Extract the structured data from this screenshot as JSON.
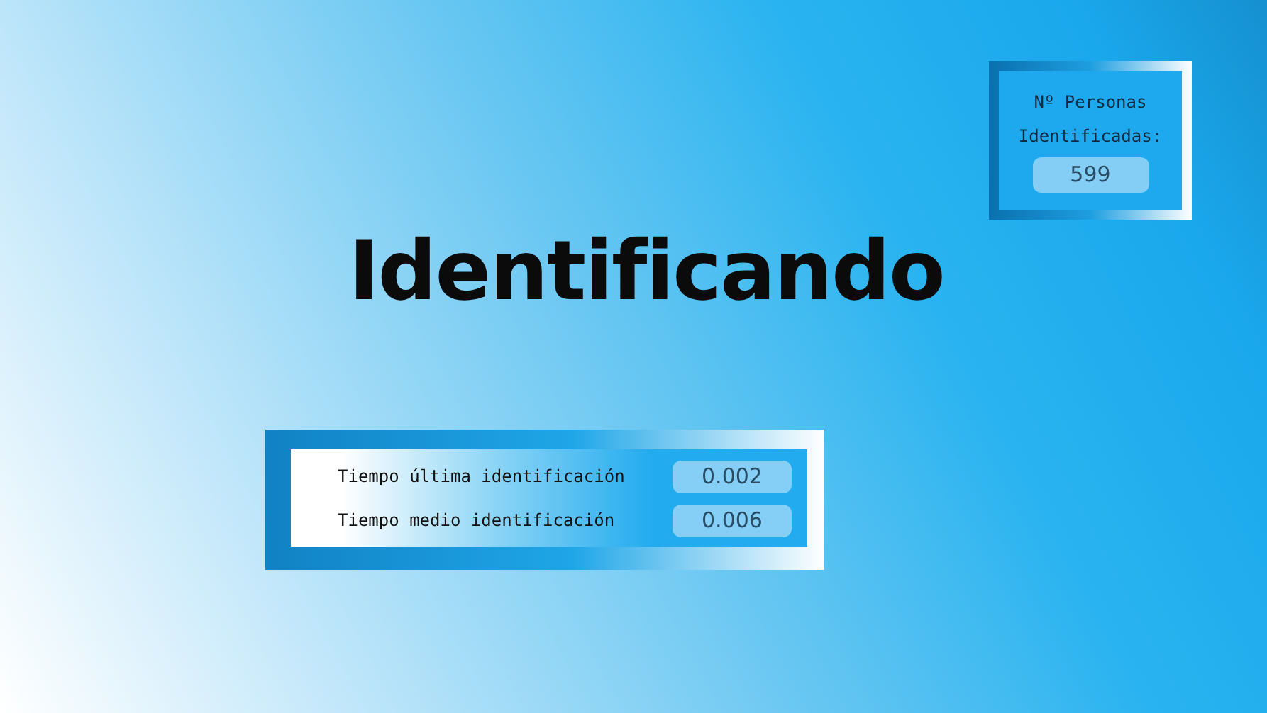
{
  "counter": {
    "label_lines": [
      "Nº Personas",
      "Identificadas:"
    ],
    "value": "599"
  },
  "title": "Identificando",
  "timings": [
    {
      "label": "Tiempo última identificación",
      "value": "0.002"
    },
    {
      "label": "Tiempo medio identificación",
      "value": "0.006"
    }
  ]
}
